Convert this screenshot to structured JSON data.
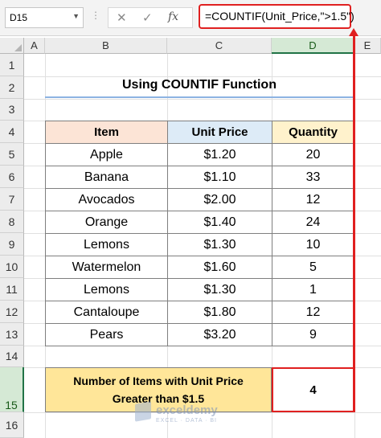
{
  "formula_bar": {
    "name_box": "D15",
    "dots": "⋮",
    "cancel_icon": "✕",
    "enter_icon": "✓",
    "fx_label": "fx",
    "formula": "=COUNTIF(Unit_Price,\">1.5\")"
  },
  "columns": [
    "A",
    "B",
    "C",
    "D",
    "E"
  ],
  "rows": [
    "1",
    "2",
    "3",
    "4",
    "5",
    "6",
    "7",
    "8",
    "9",
    "10",
    "11",
    "12",
    "13",
    "14",
    "15",
    "16"
  ],
  "selected_cell": "D15",
  "title": "Using COUNTIF Function",
  "table": {
    "headers": [
      "Item",
      "Unit Price",
      "Quantity"
    ],
    "header_colors": [
      "#fce4d6",
      "#ddebf7",
      "#fff2cc"
    ],
    "rows": [
      [
        "Apple",
        "$1.20",
        "20"
      ],
      [
        "Banana",
        "$1.10",
        "33"
      ],
      [
        "Avocados",
        "$2.00",
        "12"
      ],
      [
        "Orange",
        "$1.40",
        "24"
      ],
      [
        "Lemons",
        "$1.30",
        "10"
      ],
      [
        "Watermelon",
        "$1.60",
        "5"
      ],
      [
        "Lemons",
        "$1.30",
        "1"
      ],
      [
        "Cantaloupe",
        "$1.80",
        "12"
      ],
      [
        "Pears",
        "$3.20",
        "9"
      ]
    ]
  },
  "summary": {
    "label_line1": "Number of Items with Unit Price",
    "label_line2": "Greater than $1.5",
    "value": "4"
  },
  "watermark": {
    "name": "exceldemy",
    "tagline": "EXCEL · DATA · BI"
  },
  "colors": {
    "highlight": "#e02020",
    "summary_fill": "#ffe699",
    "selection": "#217346"
  }
}
